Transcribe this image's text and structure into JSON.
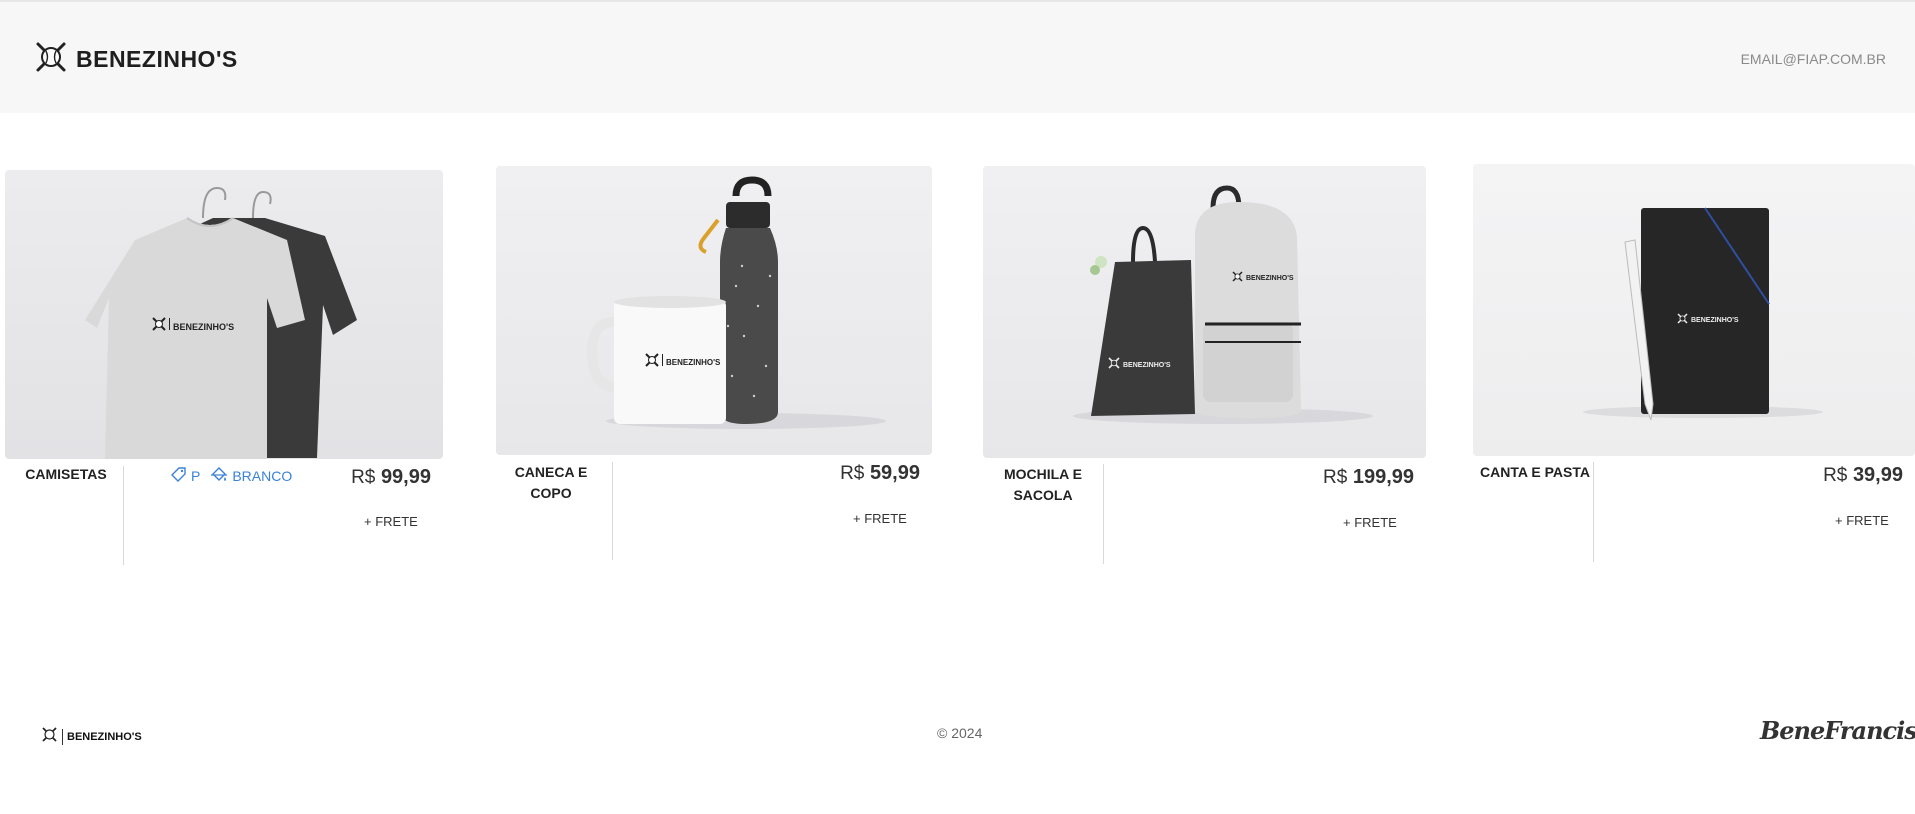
{
  "header": {
    "brand": "BENEZINHO'S",
    "email": "EMAIL@FIAP.COM.BR"
  },
  "products": [
    {
      "name": "CAMISETAS",
      "currency": "R$",
      "price": "99,99",
      "shipping": "+ FRETE",
      "size": "P",
      "color": "BRANCO",
      "image": "t-shirts-on-hangers",
      "logo_text": "BENEZINHO'S"
    },
    {
      "name": "CANECA E COPO",
      "currency": "R$",
      "price": "59,99",
      "shipping": "+ FRETE",
      "image": "mug-and-bottle",
      "logo_text": "BENEZINHO'S"
    },
    {
      "name": "MOCHILA E SACOLA",
      "currency": "R$",
      "price": "199,99",
      "shipping": "+ FRETE",
      "image": "backpack-and-tote-bag",
      "logo_text": "BENEZINHO'S"
    },
    {
      "name": "CANTA E PASTA",
      "currency": "R$",
      "price": "39,99",
      "shipping": "+ FRETE",
      "image": "pen-and-folder",
      "logo_text": "BENEZINHO'S"
    }
  ],
  "footer": {
    "brand": "BENEZINHO'S",
    "copyright": "© 2024",
    "signature": "BeneFrancis"
  },
  "icons": {
    "brand": "baseball-logo-icon",
    "size": "tag-icon",
    "color": "paint-bucket-icon"
  },
  "colors": {
    "accent": "#3b82d6",
    "header_bg": "#f7f7f7"
  }
}
